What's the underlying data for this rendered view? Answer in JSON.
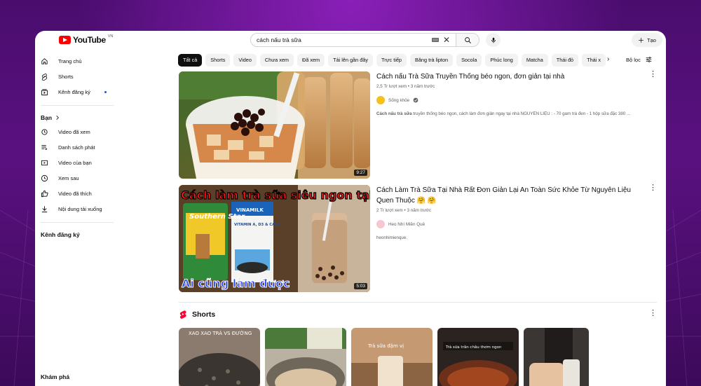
{
  "header": {
    "logo_word": "YouTube",
    "country_code": "VN",
    "search_value": "cách nấu trà sữa",
    "create_label": "Tạo"
  },
  "sidebar": {
    "main": [
      {
        "label": "Trang chủ",
        "icon": "home-icon"
      },
      {
        "label": "Shorts",
        "icon": "shorts-icon"
      },
      {
        "label": "Kênh đăng ký",
        "icon": "subscriptions-icon"
      }
    ],
    "you_heading": "Bạn",
    "you": [
      {
        "label": "Video đã xem",
        "icon": "history-icon"
      },
      {
        "label": "Danh sách phát",
        "icon": "playlist-icon"
      },
      {
        "label": "Video của bạn",
        "icon": "your-videos-icon"
      },
      {
        "label": "Xem sau",
        "icon": "watch-later-icon"
      },
      {
        "label": "Video đã thích",
        "icon": "like-icon"
      },
      {
        "label": "Nội dung tải xuống",
        "icon": "download-icon"
      }
    ],
    "subscriptions_heading": "Kênh đăng ký",
    "explore_heading": "Khám phá"
  },
  "chips": [
    "Tất cả",
    "Shorts",
    "Video",
    "Chưa xem",
    "Đã xem",
    "Tải lên gần đây",
    "Trực tiếp",
    "Băng trà lipton",
    "Socola",
    "Phúc long",
    "Matcha",
    "Thái đỏ",
    "Thái x"
  ],
  "filter_label": "Bộ lọc",
  "results": [
    {
      "title": "Cách nấu Trà Sữa Truyền Thống béo ngon, đơn giản tại nhà",
      "views": "2,5 Tr lượt xem",
      "age": "3 năm trước",
      "channel": "Sống khỏe",
      "verified": true,
      "description_bold": "Cách nấu trà sữa",
      "description": " truyền thống béo ngon, cách làm đơn giản ngay tại nhà NGUYÊN LIỆU : - 70 gam trà đen - 1 hộp sữa đặc 380 ...",
      "duration": "9:27"
    },
    {
      "title": "Cách Làm Trà Sữa Tại Nhà Rất Đơn Giản Lại An Toàn Sức Khỏe Từ Nguyên Liệu Quen Thuộc 🤗 🤗",
      "views": "2 Tr lượt xem",
      "age": "3 năm trước",
      "channel": "Heo Nhí Miền Quê",
      "verified": false,
      "description": "heonhimienque.",
      "duration": "5:03",
      "thumb_top_text": "Cách làm trà sữa siêu ngon tại nhà",
      "thumb_bottom_text": "Ai cũng làm được",
      "thumb_can_brand": "Southern Star",
      "thumb_box_brand": "VINAMILK",
      "thumb_box_text": "VITAMIN A, D3 & CANXI"
    }
  ],
  "shorts": {
    "heading": "Shorts",
    "items": [
      {
        "overlay": "XAO XAO TRÀ VS ĐƯỜNG"
      },
      {
        "overlay": ""
      },
      {
        "overlay": "Trà sữa đậm vị"
      },
      {
        "overlay": "Trà sữa trân châu thơm ngon"
      },
      {
        "overlay": ""
      }
    ]
  },
  "colors": {
    "brand": "#ff0000",
    "background_purple": "#5a1180",
    "chip_active": "#0f0f0f"
  }
}
